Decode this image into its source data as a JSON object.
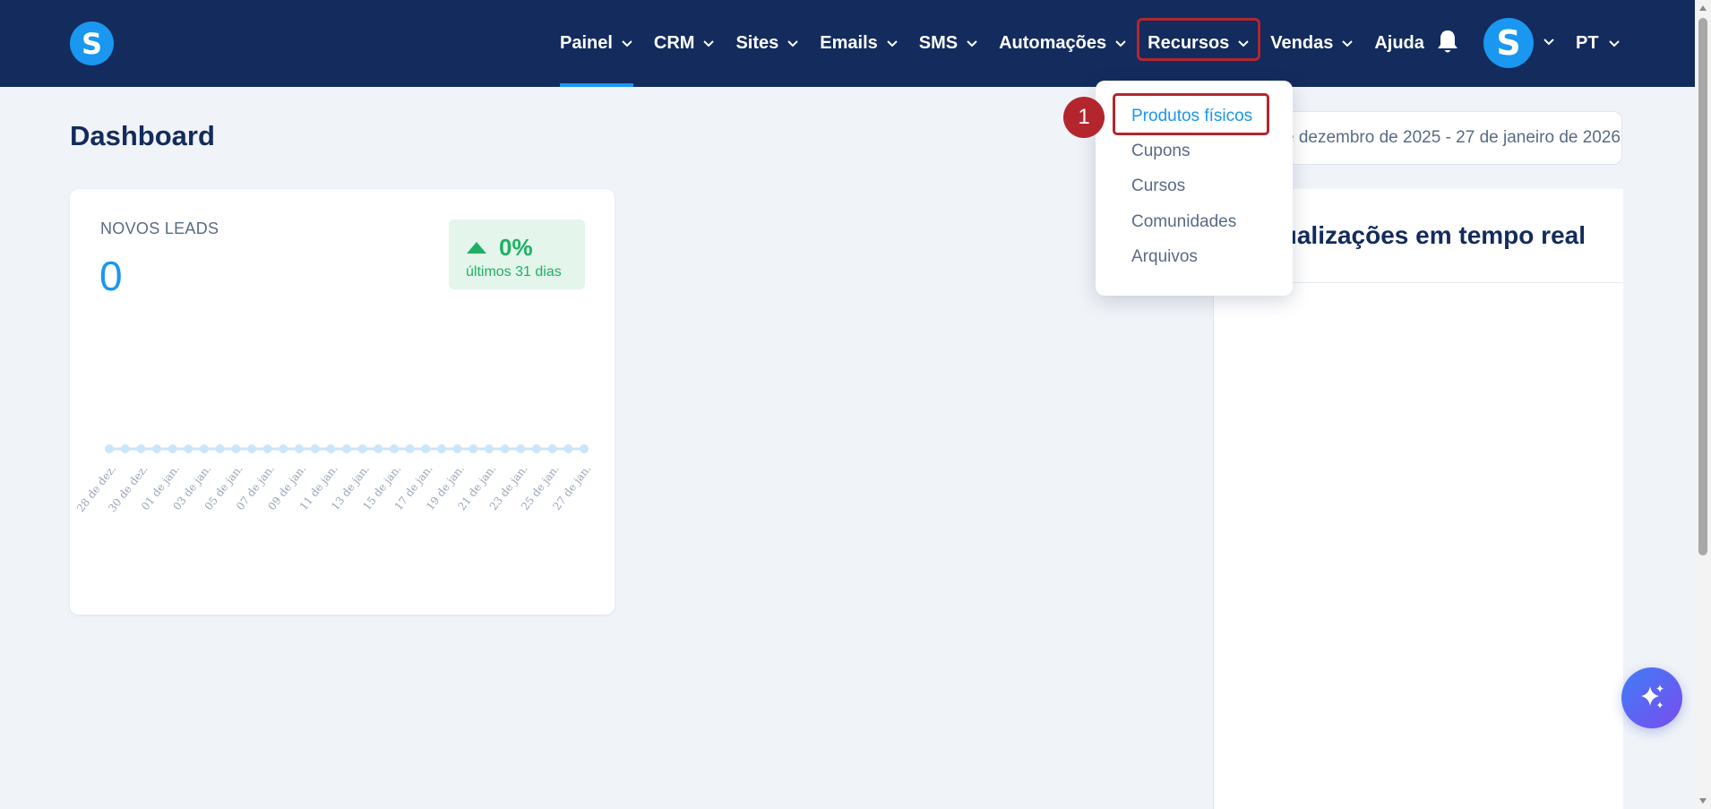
{
  "nav": {
    "logo_letter": "S",
    "items": [
      {
        "label": "Painel",
        "has_chevron": true
      },
      {
        "label": "CRM",
        "has_chevron": true
      },
      {
        "label": "Sites",
        "has_chevron": true
      },
      {
        "label": "Emails",
        "has_chevron": true
      },
      {
        "label": "SMS",
        "has_chevron": true
      },
      {
        "label": "Automações",
        "has_chevron": true
      },
      {
        "label": "Recursos",
        "has_chevron": true
      },
      {
        "label": "Vendas",
        "has_chevron": true
      },
      {
        "label": "Ajuda",
        "has_chevron": false
      }
    ],
    "active_item": "Painel",
    "open_item": "Recursos",
    "bell_icon": "bell-icon",
    "avatar_letter": "S",
    "language": "PT"
  },
  "page": {
    "title": "Dashboard",
    "date_range": "28 de dezembro de 2025 - 27 de janeiro de 2026"
  },
  "leads_card": {
    "label": "NOVOS LEADS",
    "value": "0",
    "trend_value": "0%",
    "trend_period": "últimos 31 dias",
    "trend_icon": "triangle-up-icon"
  },
  "chart_data": {
    "type": "line",
    "x": [
      "28 de dez.",
      "29 de dez.",
      "30 de dez.",
      "31 de dez.",
      "01 de jan.",
      "02 de jan.",
      "03 de jan.",
      "04 de jan.",
      "05 de jan.",
      "06 de jan.",
      "07 de jan.",
      "08 de jan.",
      "09 de jan.",
      "10 de jan.",
      "11 de jan.",
      "12 de jan.",
      "13 de jan.",
      "14 de jan.",
      "15 de jan.",
      "16 de jan.",
      "17 de jan.",
      "18 de jan.",
      "19 de jan.",
      "20 de jan.",
      "21 de jan.",
      "22 de jan.",
      "23 de jan.",
      "24 de jan.",
      "25 de jan.",
      "26 de jan.",
      "27 de jan."
    ],
    "tick_labels": [
      "28 de dez.",
      "30 de dez.",
      "01 de jan.",
      "03 de jan.",
      "05 de jan.",
      "07 de jan.",
      "09 de jan.",
      "11 de jan.",
      "13 de jan.",
      "15 de jan.",
      "17 de jan.",
      "19 de jan.",
      "21 de jan.",
      "23 de jan.",
      "25 de jan.",
      "27 de jan."
    ],
    "series": [
      {
        "values": [
          0,
          0,
          0,
          0,
          0,
          0,
          0,
          0,
          0,
          0,
          0,
          0,
          0,
          0,
          0,
          0,
          0,
          0,
          0,
          0,
          0,
          0,
          0,
          0,
          0,
          0,
          0,
          0,
          0,
          0,
          0
        ]
      }
    ],
    "color": "#c9e6fb",
    "grid": false
  },
  "dropdown": {
    "items": [
      {
        "label": "Produtos físicos",
        "active": true
      },
      {
        "label": "Cupons",
        "active": false
      },
      {
        "label": "Cursos",
        "active": false
      },
      {
        "label": "Comunidades",
        "active": false
      },
      {
        "label": "Arquivos",
        "active": false
      }
    ],
    "step_number": "1"
  },
  "live_card": {
    "title": "Atualizações em tempo real"
  },
  "fab": {
    "icon": "sparkles-icon"
  },
  "colors": {
    "nav_bg": "#132b5d",
    "accent": "#1a97f0",
    "highlight": "#b3262e",
    "success": "#1fb063",
    "page_bg": "#f0f3f8"
  }
}
